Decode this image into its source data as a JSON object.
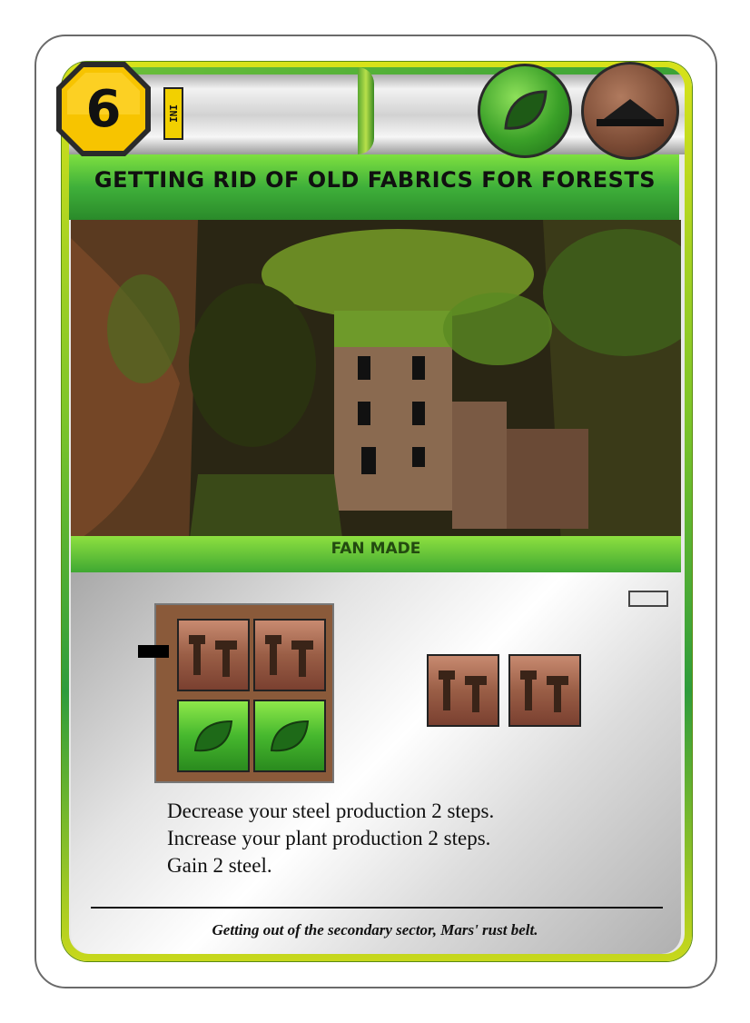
{
  "card": {
    "cost": "6",
    "set_badge": "INI",
    "title": "GETTING RID OF OLD FABRICS FOR FORESTS",
    "tags": [
      "plant-tag",
      "building-tag"
    ],
    "image_label": "FAN MADE",
    "production": {
      "decrease": {
        "resource": "steel",
        "amount": 2
      },
      "increase": {
        "resource": "plant",
        "amount": 2
      }
    },
    "gain": {
      "resource": "steel",
      "amount": 2
    },
    "description": [
      "Decrease your steel production 2 steps.",
      "Increase your plant production 2 steps.",
      "Gain 2 steel."
    ],
    "flavor": "Getting out of the secondary sector, Mars' rust belt."
  },
  "colors": {
    "border_green": "#3aa236",
    "border_yellow": "#d8e21a",
    "cost_yellow": "#f7c400",
    "steel_brown": "#9a5e46",
    "plant_green": "#46b82e"
  }
}
